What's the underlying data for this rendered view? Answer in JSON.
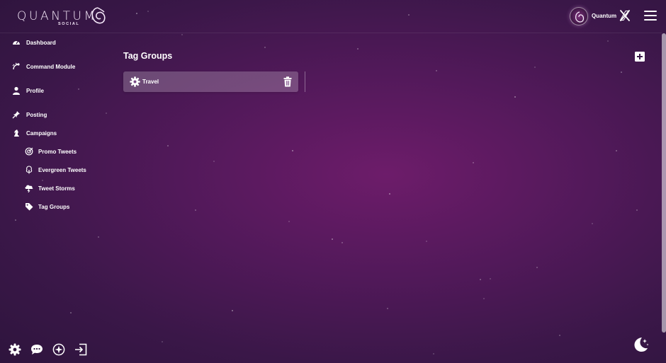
{
  "header": {
    "logo": {
      "wordmark": "QUANTUM",
      "subtitle": "SOCIAL"
    },
    "account": {
      "name": "Quantum"
    },
    "menu_icon": "hamburger-menu-icon"
  },
  "sidebar": {
    "items": [
      {
        "label": "Dashboard",
        "icon": "speedometer-icon"
      },
      {
        "label": "Command Module",
        "icon": "satellite-icon"
      },
      {
        "label": "Profile",
        "icon": "user-icon"
      },
      {
        "label": "Posting",
        "icon": "pin-icon"
      },
      {
        "label": "Campaigns",
        "icon": "chess-knight-icon"
      }
    ],
    "sub_items": [
      {
        "label": "Promo Tweets",
        "icon": "target-icon"
      },
      {
        "label": "Evergreen Tweets",
        "icon": "tree-icon"
      },
      {
        "label": "Tweet Storms",
        "icon": "storm-cloud-icon"
      },
      {
        "label": "Tag Groups",
        "icon": "tag-icon"
      }
    ],
    "footer_icons": [
      "settings-gear-icon",
      "chat-bubble-icon",
      "compass-icon",
      "logout-icon"
    ]
  },
  "main": {
    "title": "Tag Groups",
    "add_icon": "plus-square-icon",
    "tag_groups": [
      {
        "name": "Travel"
      }
    ]
  },
  "theme_icon": "moon-stars-icon",
  "colors": {
    "background_center": "#6d1c6a",
    "background_edge": "#2e143d",
    "text": "#ffffff",
    "card": "rgba(255,255,255,0.22)"
  }
}
